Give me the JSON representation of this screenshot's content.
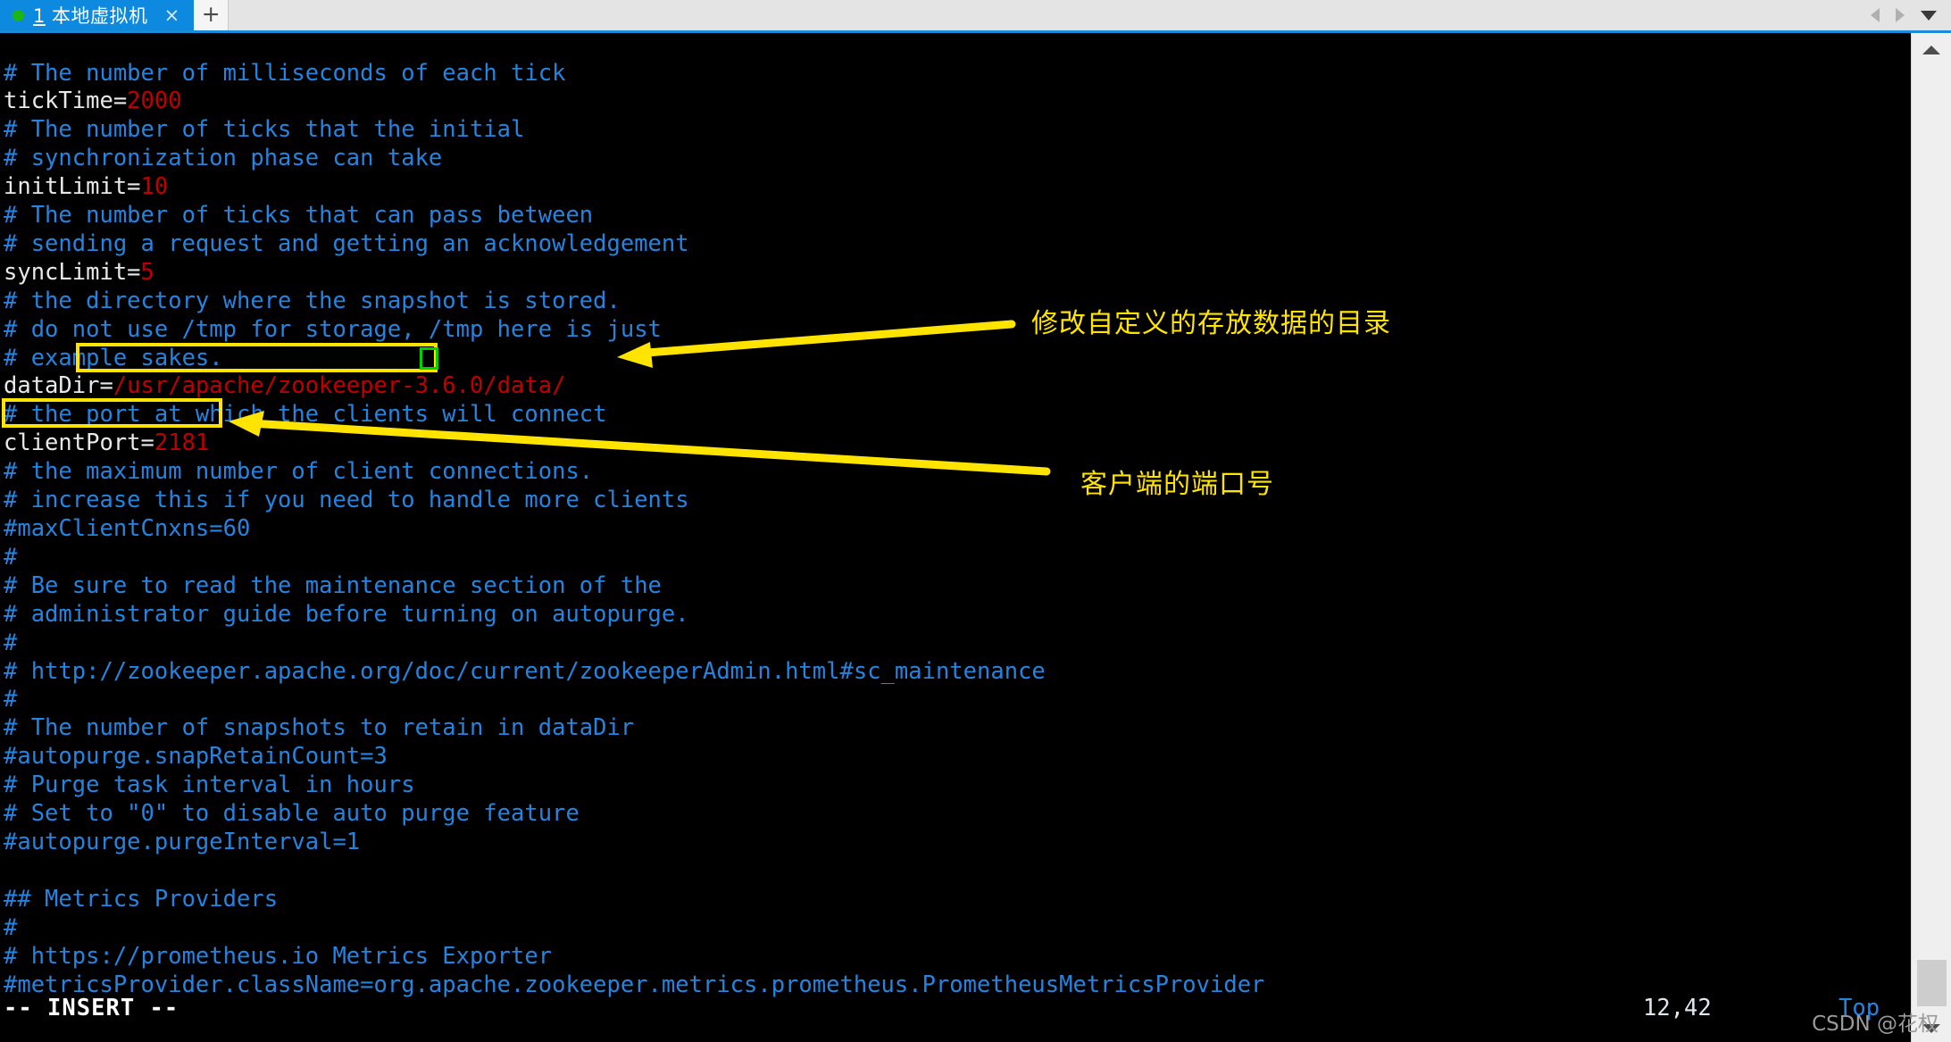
{
  "window": {
    "tab": {
      "status_dot": "green-status-dot",
      "number": "1",
      "title": " 本地虚拟机",
      "close_label": "×"
    },
    "new_tab_label": "+",
    "nav": {
      "prev": "prev-tab-arrow",
      "next": "next-tab-arrow",
      "list": "tab-list-caret"
    }
  },
  "editor": {
    "lines": [
      {
        "type": "comment",
        "text": "# The number of milliseconds of each tick"
      },
      {
        "type": "kv",
        "key": "tickTime=",
        "value": "2000"
      },
      {
        "type": "comment",
        "text": "# The number of ticks that the initial"
      },
      {
        "type": "comment",
        "text": "# synchronization phase can take"
      },
      {
        "type": "kv",
        "key": "initLimit=",
        "value": "10"
      },
      {
        "type": "comment",
        "text": "# The number of ticks that can pass between"
      },
      {
        "type": "comment",
        "text": "# sending a request and getting an acknowledgement"
      },
      {
        "type": "kv",
        "key": "syncLimit=",
        "value": "5"
      },
      {
        "type": "comment",
        "text": "# the directory where the snapshot is stored."
      },
      {
        "type": "comment",
        "text": "# do not use /tmp for storage, /tmp here is just"
      },
      {
        "type": "comment",
        "text": "# example sakes."
      },
      {
        "type": "kv",
        "key": "dataDir=",
        "value": "/usr/apache/zookeeper-3.6.0/data/"
      },
      {
        "type": "comment",
        "text": "# the port at which the clients will connect"
      },
      {
        "type": "kv",
        "key": "clientPort=",
        "value": "2181"
      },
      {
        "type": "comment",
        "text": "# the maximum number of client connections."
      },
      {
        "type": "comment",
        "text": "# increase this if you need to handle more clients"
      },
      {
        "type": "comment",
        "text": "#maxClientCnxns=60"
      },
      {
        "type": "comment",
        "text": "#"
      },
      {
        "type": "comment",
        "text": "# Be sure to read the maintenance section of the"
      },
      {
        "type": "comment",
        "text": "# administrator guide before turning on autopurge."
      },
      {
        "type": "comment",
        "text": "#"
      },
      {
        "type": "comment",
        "text": "# http://zookeeper.apache.org/doc/current/zookeeperAdmin.html#sc_maintenance"
      },
      {
        "type": "comment",
        "text": "#"
      },
      {
        "type": "comment",
        "text": "# The number of snapshots to retain in dataDir"
      },
      {
        "type": "comment",
        "text": "#autopurge.snapRetainCount=3"
      },
      {
        "type": "comment",
        "text": "# Purge task interval in hours"
      },
      {
        "type": "comment",
        "text": "# Set to \"0\" to disable auto purge feature"
      },
      {
        "type": "comment",
        "text": "#autopurge.purgeInterval=1"
      },
      {
        "type": "blank",
        "text": ""
      },
      {
        "type": "comment",
        "text": "## Metrics Providers"
      },
      {
        "type": "comment",
        "text": "#"
      },
      {
        "type": "comment",
        "text": "# https://prometheus.io Metrics Exporter"
      },
      {
        "type": "comment",
        "text": "#metricsProvider.className=org.apache.zookeeper.metrics.prometheus.PrometheusMetricsProvider"
      }
    ],
    "status": {
      "mode": "-- INSERT --",
      "position": "12,42",
      "scroll": "Top"
    }
  },
  "annotations": [
    {
      "id": "datadir-note",
      "text": "修改自定义的存放数据的目录"
    },
    {
      "id": "clientport-note",
      "text": "客户端的端口号"
    }
  ],
  "colors": {
    "comment": "#2484e0",
    "key": "#e8e8e8",
    "value": "#c00000",
    "annotation": "#ffe400",
    "cursor": "#00d200",
    "tab_active": "#0d8ae0",
    "status_dot": "#1db514"
  },
  "watermark": "CSDN @花权"
}
